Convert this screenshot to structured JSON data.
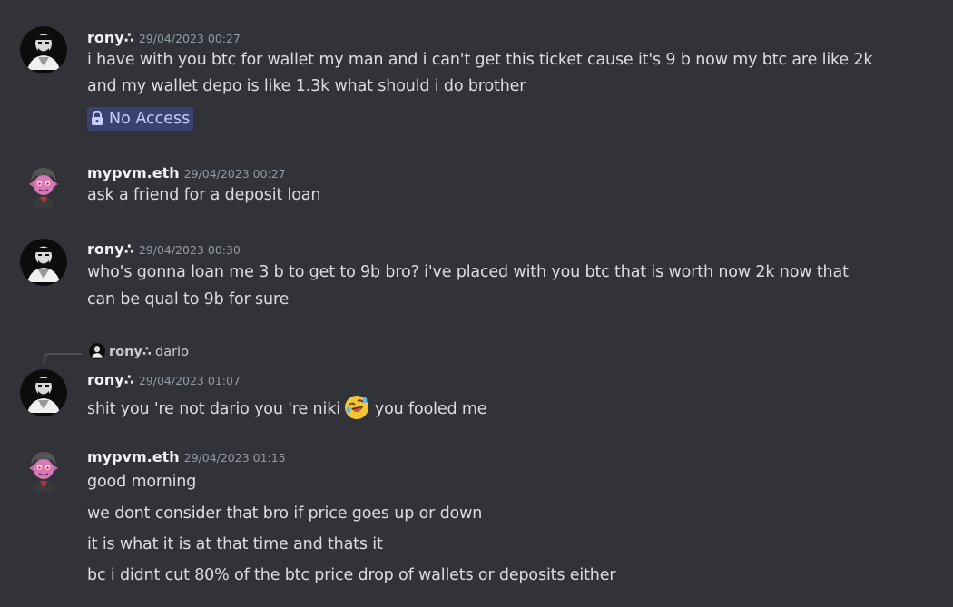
{
  "colors": {
    "background": "#313338",
    "username": "#f2f3f5",
    "timestamp": "#949ba4",
    "text": "#dbdee1",
    "no_access_bg": "#3c4270",
    "no_access_text": "#c9cdfb"
  },
  "messages": [
    {
      "username": "rony∴",
      "timestamp": "29/04/2023 00:27",
      "lines": [
        "i have with you btc for wallet my man and i can't get this ticket cause it's 9 b now my btc are like 2k",
        "and my wallet depo is like 1.3k what should i do brother"
      ],
      "channel_chip": {
        "icon": "lock-icon",
        "label": "No Access"
      }
    },
    {
      "username": "mypvm.eth",
      "timestamp": "29/04/2023 00:27",
      "lines": [
        "ask a friend for a deposit loan"
      ]
    },
    {
      "username": "rony∴",
      "timestamp": "29/04/2023 00:30",
      "lines": [
        "who's gonna loan me  3 b to get to 9b bro? i've placed with you btc that is worth now 2k now that",
        "can be qual to 9b for sure"
      ]
    },
    {
      "reply": {
        "username": "rony∴",
        "text": "dario"
      },
      "username": "rony∴",
      "timestamp": "29/04/2023 01:07",
      "text_before": "shit you 're not dario you 're niki",
      "emoji": "rofl-emoji-icon",
      "text_after": "you fooled me"
    },
    {
      "username": "mypvm.eth",
      "timestamp": "29/04/2023 01:15",
      "lines": [
        "good morning",
        "we dont consider that bro if price goes up or down",
        "it is what it is at that time and thats it",
        "bc i didnt cut 80% of the btc price drop of wallets or deposits either"
      ]
    }
  ]
}
